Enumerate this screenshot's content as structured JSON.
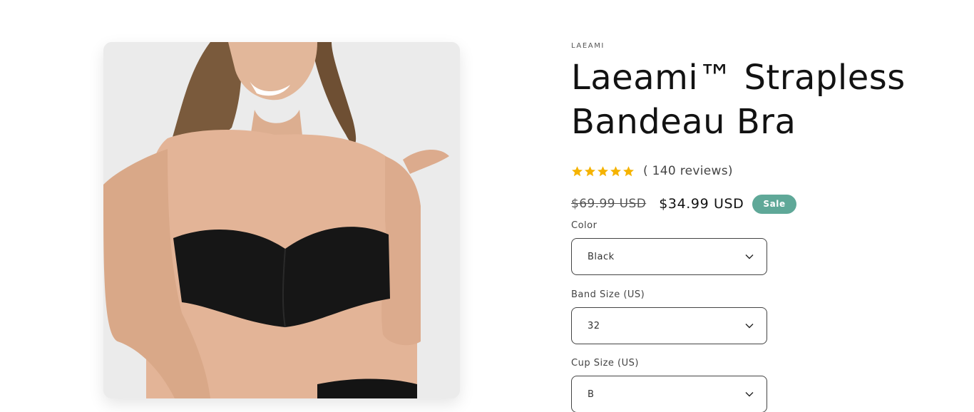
{
  "product": {
    "vendor": "LAEAMI",
    "title": "Laeami™ Strapless Bandeau Bra",
    "image_alt": "Model wearing black strapless bandeau bra"
  },
  "rating": {
    "stars": 5,
    "reviews_text": "( 140 reviews)",
    "star_color": "#f5b301"
  },
  "price": {
    "regular": "$69.99 USD",
    "sale": "$34.99 USD",
    "badge": "Sale",
    "badge_color": "#5fa898"
  },
  "options": {
    "color": {
      "label": "Color",
      "value": "Black"
    },
    "band_size": {
      "label": "Band Size (US)",
      "value": "32"
    },
    "cup_size": {
      "label": "Cup Size (US)",
      "value": "B"
    }
  },
  "icons": {
    "star": "star-icon",
    "chevron": "chevron-down-icon"
  }
}
